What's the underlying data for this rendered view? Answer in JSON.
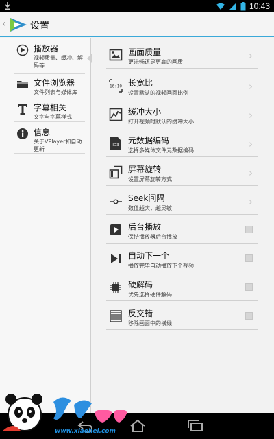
{
  "status_bar": {
    "time": "10:43"
  },
  "action_bar": {
    "title": "设置"
  },
  "sidebar": {
    "items": [
      {
        "title": "播放器",
        "subtitle": "视频质量、缓冲、解码等",
        "icon": "play-circle-icon",
        "selected": true
      },
      {
        "title": "文件浏览器",
        "subtitle": "文件列表与媒体库",
        "icon": "folder-icon"
      },
      {
        "title": "字幕相关",
        "subtitle": "文字与字幕样式",
        "icon": "text-t-icon"
      },
      {
        "title": "信息",
        "subtitle": "关于VPlayer和自动更新",
        "icon": "info-icon"
      }
    ]
  },
  "settings": {
    "items": [
      {
        "title": "画面质量",
        "subtitle": "更流畅还是更高的画质",
        "icon": "picture-quality-icon",
        "control": "chevron"
      },
      {
        "title": "长宽比",
        "subtitle": "设置默认的视频画面比例",
        "icon": "aspect-ratio-icon",
        "control": "chevron",
        "icon_text": "16:10"
      },
      {
        "title": "缓冲大小",
        "subtitle": "打开视频时默认的缓冲大小",
        "icon": "buffer-chart-icon",
        "control": "chevron"
      },
      {
        "title": "元数据编码",
        "subtitle": "选择多媒体文件元数据编码",
        "icon": "metadata-encoding-icon",
        "control": "chevron",
        "icon_text": "ID3"
      },
      {
        "title": "屏幕旋转",
        "subtitle": "设置屏幕旋转方式",
        "icon": "rotate-screen-icon",
        "control": "chevron"
      },
      {
        "title": "Seek间隔",
        "subtitle": "数值越大，越灵敏",
        "icon": "seek-slider-icon",
        "control": "chevron"
      },
      {
        "title": "后台播放",
        "subtitle": "保持播放器后台播放",
        "icon": "play-box-icon",
        "control": "checkbox",
        "checked": false
      },
      {
        "title": "自动下一个",
        "subtitle": "播放完毕自动播放下个视频",
        "icon": "skip-next-icon",
        "control": "checkbox",
        "checked": false
      },
      {
        "title": "硬解码",
        "subtitle": "优先选择硬件解码",
        "icon": "chip-icon",
        "control": "checkbox",
        "checked": false
      },
      {
        "title": "反交错",
        "subtitle": "移除画面中的横线",
        "icon": "deinterlace-icon",
        "control": "checkbox",
        "checked": false
      }
    ]
  },
  "watermark": {
    "url": "www.xiaohei.com"
  },
  "colors": {
    "accent": "#3aa9d9",
    "background": "#f2f2f2",
    "status_bar": "#000000"
  }
}
